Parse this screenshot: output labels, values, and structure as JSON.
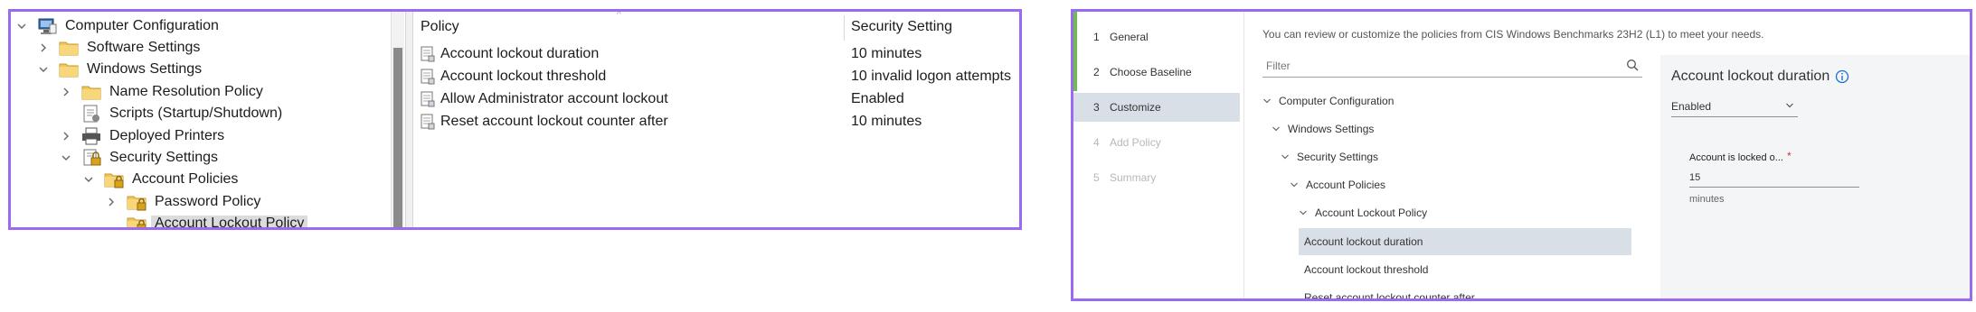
{
  "gpo_editor": {
    "tree": [
      {
        "label": "Computer Configuration",
        "expanded": true,
        "icon": "computer-config-icon"
      },
      {
        "label": "Software Settings",
        "expanded": false,
        "icon": "folder-icon"
      },
      {
        "label": "Windows Settings",
        "expanded": true,
        "icon": "folder-icon"
      },
      {
        "label": "Name Resolution Policy",
        "expanded": false,
        "icon": "folder-icon"
      },
      {
        "label": "Scripts (Startup/Shutdown)",
        "expanded": null,
        "icon": "scripts-icon"
      },
      {
        "label": "Deployed Printers",
        "expanded": false,
        "icon": "printer-icon"
      },
      {
        "label": "Security Settings",
        "expanded": true,
        "icon": "security-settings-icon"
      },
      {
        "label": "Account Policies",
        "expanded": true,
        "icon": "folder-lock-icon"
      },
      {
        "label": "Password Policy",
        "expanded": false,
        "icon": "folder-lock-icon"
      },
      {
        "label": "Account Lockout Policy",
        "expanded": null,
        "icon": "folder-lock-icon",
        "selected": true
      }
    ],
    "columns": {
      "policy": "Policy",
      "setting": "Security Setting"
    },
    "rows": [
      {
        "policy": "Account lockout duration",
        "setting": "10 minutes"
      },
      {
        "policy": "Account lockout threshold",
        "setting": "10 invalid logon attempts"
      },
      {
        "policy": "Allow Administrator account lockout",
        "setting": "Enabled"
      },
      {
        "policy": "Reset account lockout counter after",
        "setting": "10 minutes"
      }
    ]
  },
  "wizard": {
    "steps": [
      {
        "num": "1",
        "label": "General",
        "state": "done"
      },
      {
        "num": "2",
        "label": "Choose Baseline",
        "state": "done"
      },
      {
        "num": "3",
        "label": "Customize",
        "state": "active"
      },
      {
        "num": "4",
        "label": "Add Policy",
        "state": "disabled"
      },
      {
        "num": "5",
        "label": "Summary",
        "state": "disabled"
      }
    ],
    "intro": "You can review or customize the policies from CIS Windows Benchmarks 23H2 (L1) to meet your needs.",
    "filter_placeholder": "Filter",
    "tree": [
      {
        "label": "Computer Configuration",
        "expanded": true
      },
      {
        "label": "Windows Settings",
        "expanded": true
      },
      {
        "label": "Security Settings",
        "expanded": true
      },
      {
        "label": "Account Policies",
        "expanded": true
      },
      {
        "label": "Account Lockout Policy",
        "expanded": true
      },
      {
        "label": "Account lockout duration",
        "selected": true
      },
      {
        "label": "Account lockout threshold"
      },
      {
        "label": "Reset account lockout counter after"
      }
    ],
    "detail": {
      "title": "Account lockout duration",
      "state_value": "Enabled",
      "field_label": "Account is locked o...",
      "required_mark": "*",
      "field_value": "15",
      "field_hint": "minutes"
    },
    "colors": {
      "accent_border": "#9a6bf0",
      "step_done": "#6cc04a",
      "selection": "#d9dfe6"
    }
  }
}
